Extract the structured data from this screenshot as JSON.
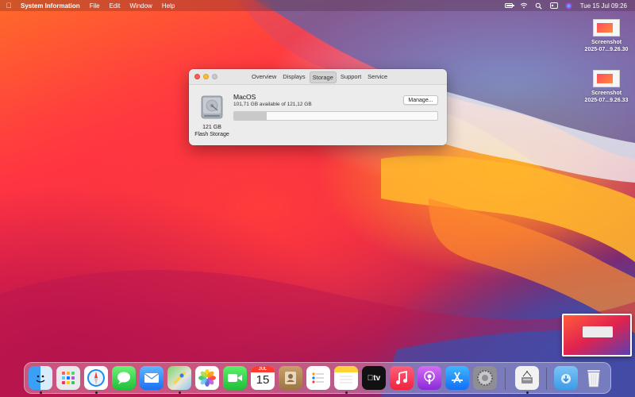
{
  "menubar": {
    "app_name": "System Information",
    "menus": [
      "File",
      "Edit",
      "Window",
      "Help"
    ],
    "clock": "Tue 15 Jul  09:26",
    "icons": [
      "apple-icon",
      "battery-icon",
      "wifi-icon",
      "search-icon",
      "control-center-icon",
      "siri-icon"
    ]
  },
  "desktop": {
    "files": [
      {
        "line1": "Screenshot",
        "line2": "2025-07...9.26.30"
      },
      {
        "line1": "Screenshot",
        "line2": "2025-07...9.26.33"
      }
    ]
  },
  "window": {
    "tabs": [
      {
        "label": "Overview",
        "active": false
      },
      {
        "label": "Displays",
        "active": false
      },
      {
        "label": "Storage",
        "active": true
      },
      {
        "label": "Support",
        "active": false
      },
      {
        "label": "Service",
        "active": false
      }
    ],
    "disk": {
      "size": "121 GB",
      "type": "Flash Storage"
    },
    "volume": {
      "name": "MacOS",
      "available": "101,71 GB available of 121,12 GB",
      "used_fraction": 0.16
    },
    "manage_label": "Manage..."
  },
  "dock": {
    "calendar_month": "JUL",
    "calendar_day": "15",
    "apps": [
      "Finder",
      "Launchpad",
      "Safari",
      "Messages",
      "Mail",
      "Maps",
      "Photos",
      "FaceTime",
      "Calendar",
      "Contacts",
      "Reminders",
      "Notes",
      "TV",
      "Music",
      "Podcasts",
      "App Store",
      "System Preferences",
      "System Information",
      "Downloads",
      "Trash"
    ],
    "tv_label": "tv"
  },
  "colors": {
    "close": "#ff5f57",
    "minimize": "#febc2e",
    "zoom": "#c8c8c8"
  }
}
